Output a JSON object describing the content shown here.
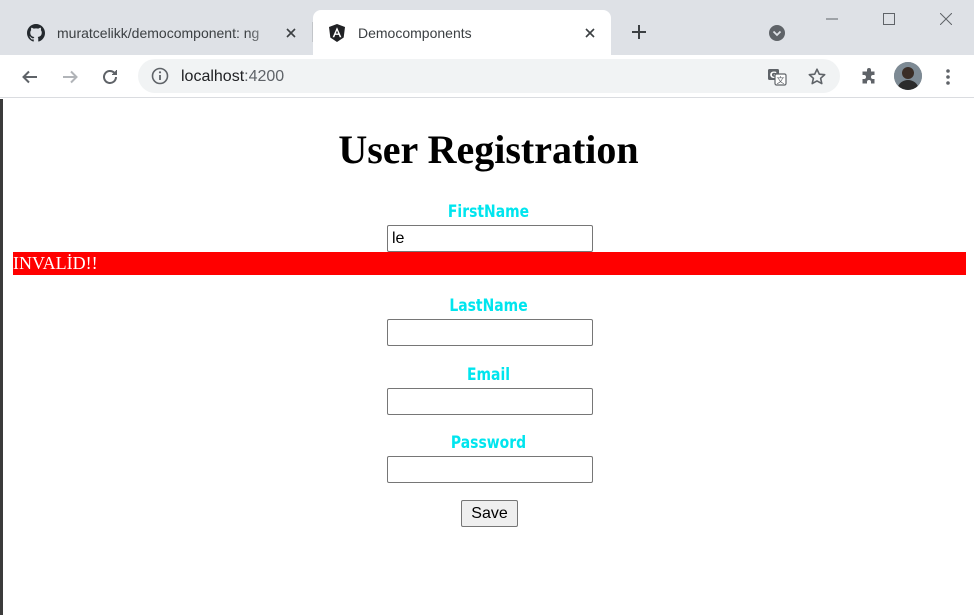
{
  "browser": {
    "tabs": [
      {
        "title": "muratcelikk/democomponent: ng",
        "favicon": "github-icon",
        "active": false
      },
      {
        "title": "Democomponents",
        "favicon": "angular-icon",
        "active": true
      }
    ],
    "address": {
      "host": "localhost",
      "port": ":4200"
    }
  },
  "page": {
    "title": "User Registration",
    "fields": [
      {
        "label": "FirstName",
        "value": "le"
      },
      {
        "label": "LastName",
        "value": ""
      },
      {
        "label": "Email",
        "value": ""
      },
      {
        "label": "Password",
        "value": ""
      }
    ],
    "invalid_message": "INVALİD!!",
    "save_label": "Save"
  },
  "colors": {
    "label": "#00e5ee",
    "invalid_bg": "#ff0000",
    "tabstrip_bg": "#dee1e6"
  }
}
